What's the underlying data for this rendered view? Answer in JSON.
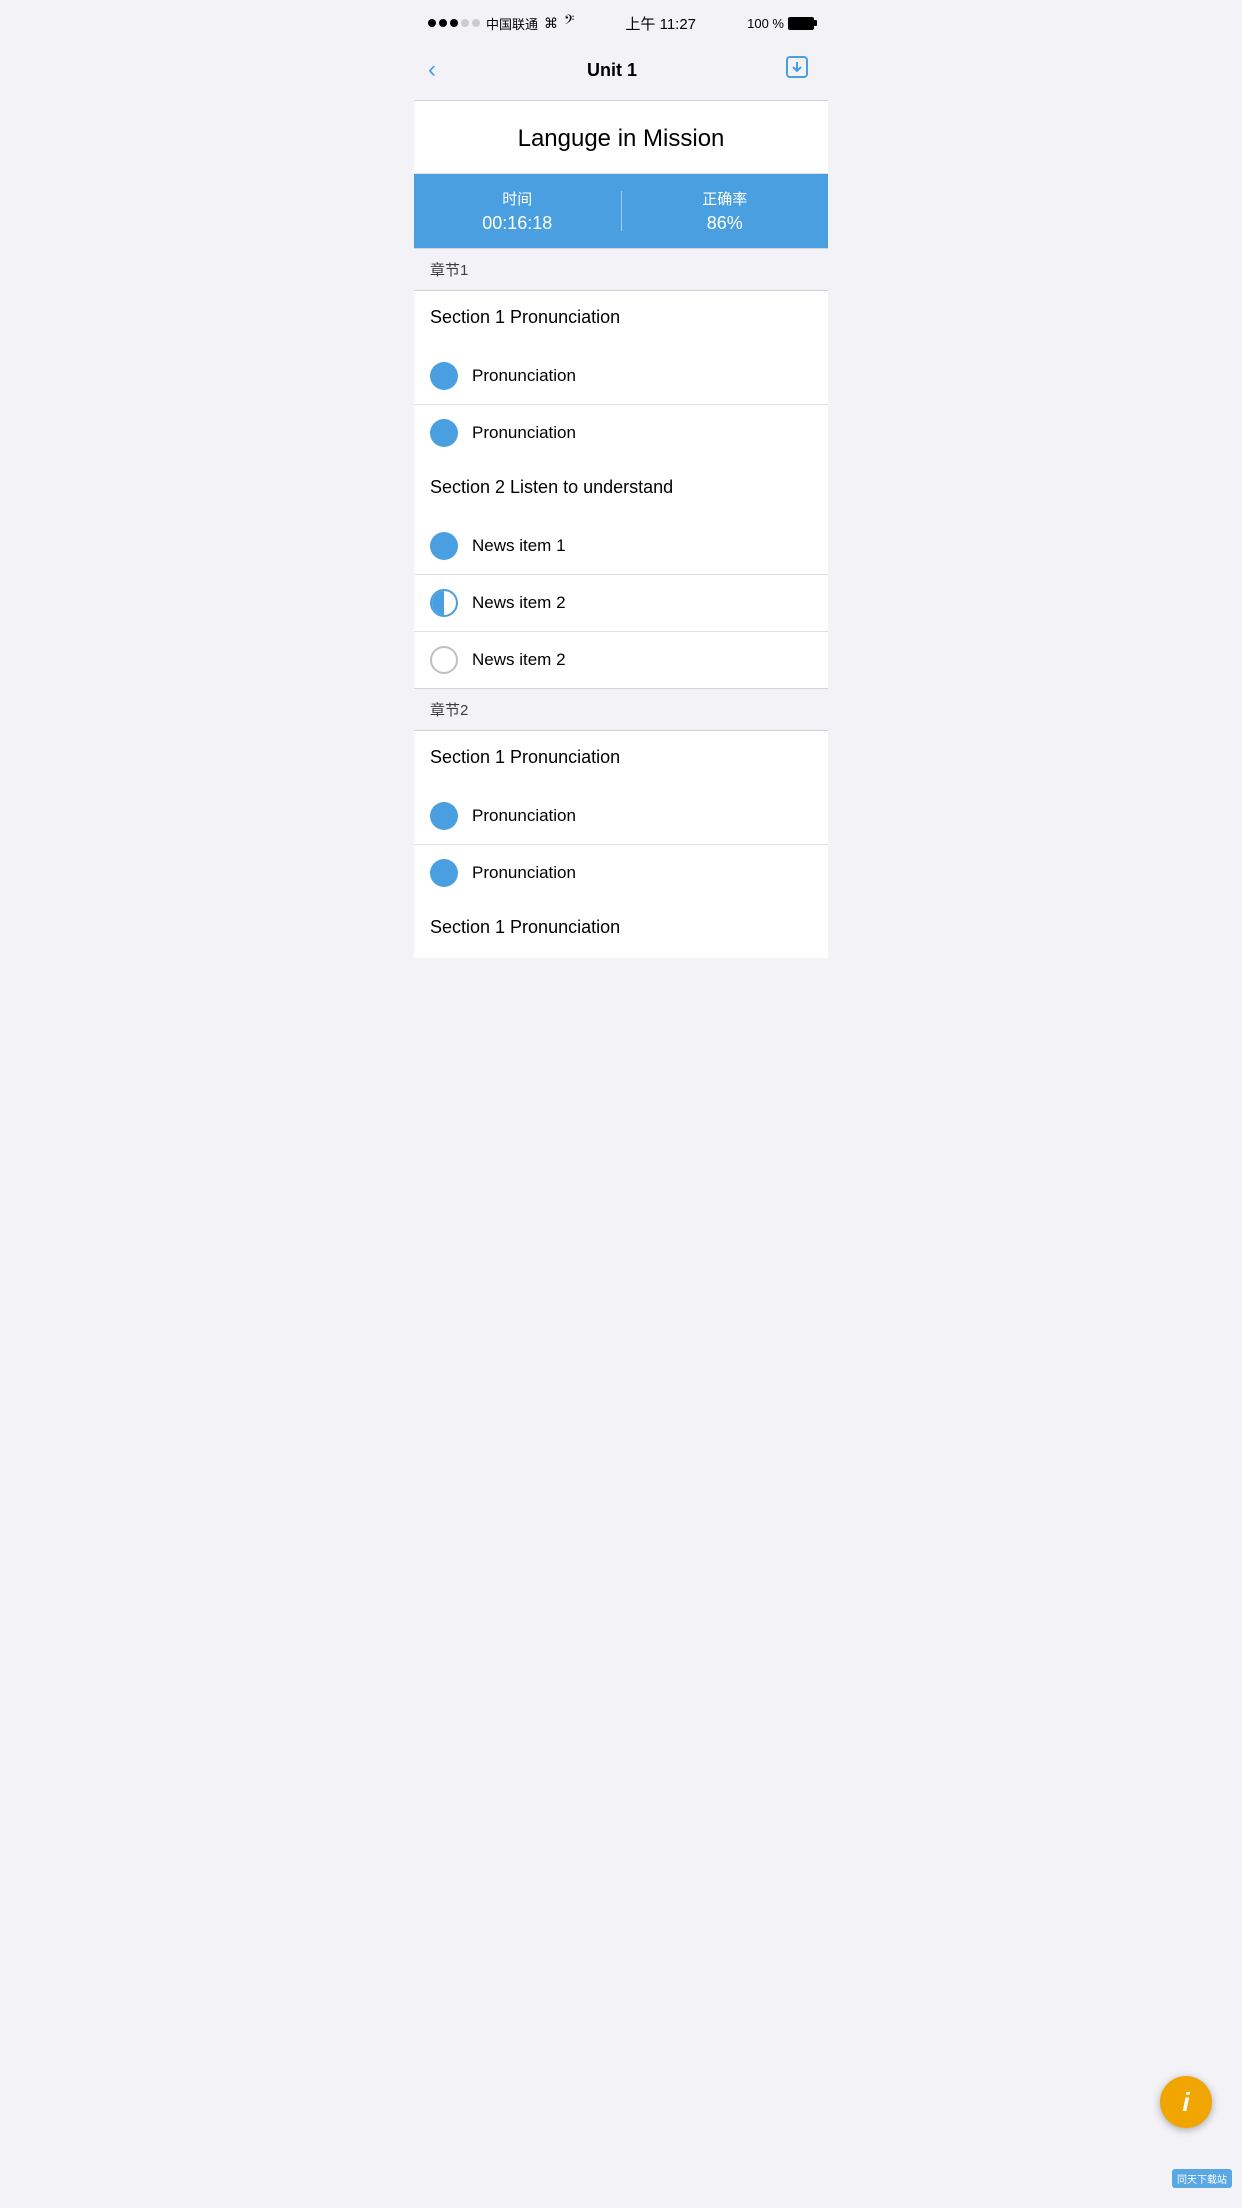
{
  "statusBar": {
    "carrier": "中国联通",
    "time": "上午 11:27",
    "battery": "100 %"
  },
  "navBar": {
    "backLabel": "‹",
    "title": "Unit 1",
    "downloadIcon": "⬇"
  },
  "pageTitle": "Languge in Mission",
  "statsBar": {
    "timeLabel": "时间",
    "timeValue": "00:16:18",
    "accuracyLabel": "正确率",
    "accuracyValue": "86%"
  },
  "sections": [
    {
      "header": "章节1",
      "groups": [
        {
          "title": "Section 1 Pronunciation",
          "items": [
            {
              "iconType": "full",
              "text": "Pronunciation"
            },
            {
              "iconType": "full",
              "text": "Pronunciation"
            }
          ]
        },
        {
          "title": "Section 2 Listen to understand",
          "items": [
            {
              "iconType": "full",
              "text": "News item 1"
            },
            {
              "iconType": "half",
              "text": "News item 2"
            },
            {
              "iconType": "empty",
              "text": "News item 2"
            }
          ]
        }
      ]
    },
    {
      "header": "章节2",
      "groups": [
        {
          "title": "Section 1 Pronunciation",
          "items": [
            {
              "iconType": "full",
              "text": "Pronunciation"
            },
            {
              "iconType": "full",
              "text": "Pronunciation"
            }
          ]
        },
        {
          "title": "Section 1 Pronunciation",
          "items": []
        }
      ]
    }
  ],
  "infoButton": "i",
  "watermark": "同天下载站"
}
